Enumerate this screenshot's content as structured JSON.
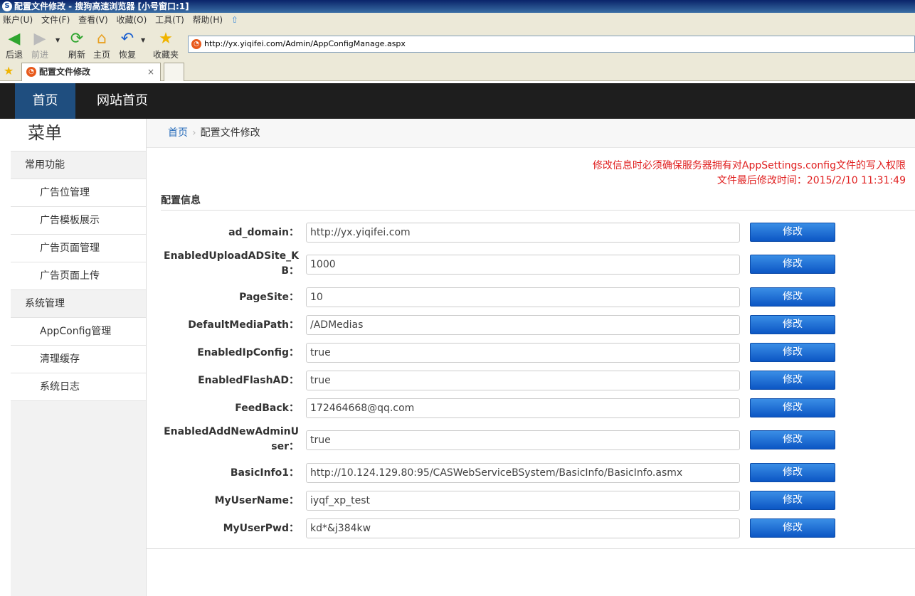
{
  "window": {
    "title": "配置文件修改 - 搜狗高速浏览器 [小号窗口:1]"
  },
  "menu": [
    "账户(U)",
    "文件(F)",
    "查看(V)",
    "收藏(O)",
    "工具(T)",
    "帮助(H)"
  ],
  "toolbar": {
    "back": "后退",
    "forward": "前进",
    "refresh": "刷新",
    "home": "主页",
    "restore": "恢复",
    "favorites": "收藏夹",
    "address": "http://yx.yiqifei.com/Admin/AppConfigManage.aspx"
  },
  "tab": {
    "title": "配置文件修改",
    "close": "×"
  },
  "nav": {
    "home": "首页",
    "site_home": "网站首页"
  },
  "sidebar": {
    "title": "菜单",
    "group1": "常用功能",
    "group1_items": [
      "广告位管理",
      "广告模板展示",
      "广告页面管理",
      "广告页面上传"
    ],
    "group2": "系统管理",
    "group2_items": [
      "AppConfig管理",
      "清理缓存",
      "系统日志"
    ]
  },
  "breadcrumb": {
    "home": "首页",
    "sep": "›",
    "current": "配置文件修改"
  },
  "notice": {
    "line1": "修改信息时必须确保服务器拥有对AppSettings.config文件的写入权限",
    "line2": "文件最后修改时间：2015/2/10 11:31:49"
  },
  "section_title": "配置信息",
  "button_label": "修改",
  "fields": [
    {
      "label": "ad_domain：",
      "value": "http://yx.yiqifei.com"
    },
    {
      "label": "EnabledUploadADSite_KB：",
      "value": "1000"
    },
    {
      "label": "PageSite：",
      "value": "10"
    },
    {
      "label": "DefaultMediaPath：",
      "value": "/ADMedias"
    },
    {
      "label": "EnabledIpConfig：",
      "value": "true"
    },
    {
      "label": "EnabledFlashAD：",
      "value": "true"
    },
    {
      "label": "FeedBack：",
      "value": "172464668@qq.com"
    },
    {
      "label": "EnabledAddNewAdminUser：",
      "value": "true"
    },
    {
      "label": "BasicInfo1：",
      "value": "http://10.124.129.80:95/CASWebServiceBSystem/BasicInfo/BasicInfo.asmx"
    },
    {
      "label": "MyUserName：",
      "value": "iyqf_xp_test"
    },
    {
      "label": "MyUserPwd：",
      "value": "kd*&j384kw"
    }
  ]
}
